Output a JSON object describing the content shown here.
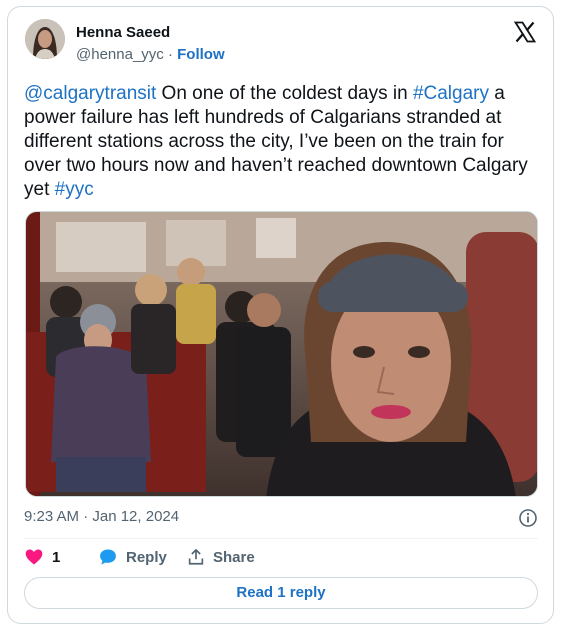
{
  "author": {
    "name": "Henna Saeed",
    "handle": "@henna_yyc",
    "separator": "·",
    "follow_label": "Follow"
  },
  "tweet": {
    "mention": "@calgarytransit",
    "text_part1": " On one of the coldest days in ",
    "hashtag1": "#Calgary",
    "text_part2": " a power failure has left hundreds of Calgarians stranded at different stations across the city, I’ve been on the train for over two hours now and haven’t reached downtown Calgary yet ",
    "hashtag2": "#yyc"
  },
  "meta": {
    "timestamp": "9:23 AM · Jan 12, 2024"
  },
  "actions": {
    "like_count": "1",
    "reply_label": "Reply",
    "share_label": "Share"
  },
  "read_reply_label": "Read 1 reply",
  "icons": {
    "logo": "x-logo-icon",
    "info": "info-icon",
    "like": "heart-icon",
    "reply": "speech-bubble-icon",
    "share": "share-arrow-icon"
  },
  "colors": {
    "link": "#1d72c4",
    "like": "#f91880",
    "reply": "#1d9bf0",
    "secondary_text": "#536471",
    "border": "#cfd9de"
  }
}
